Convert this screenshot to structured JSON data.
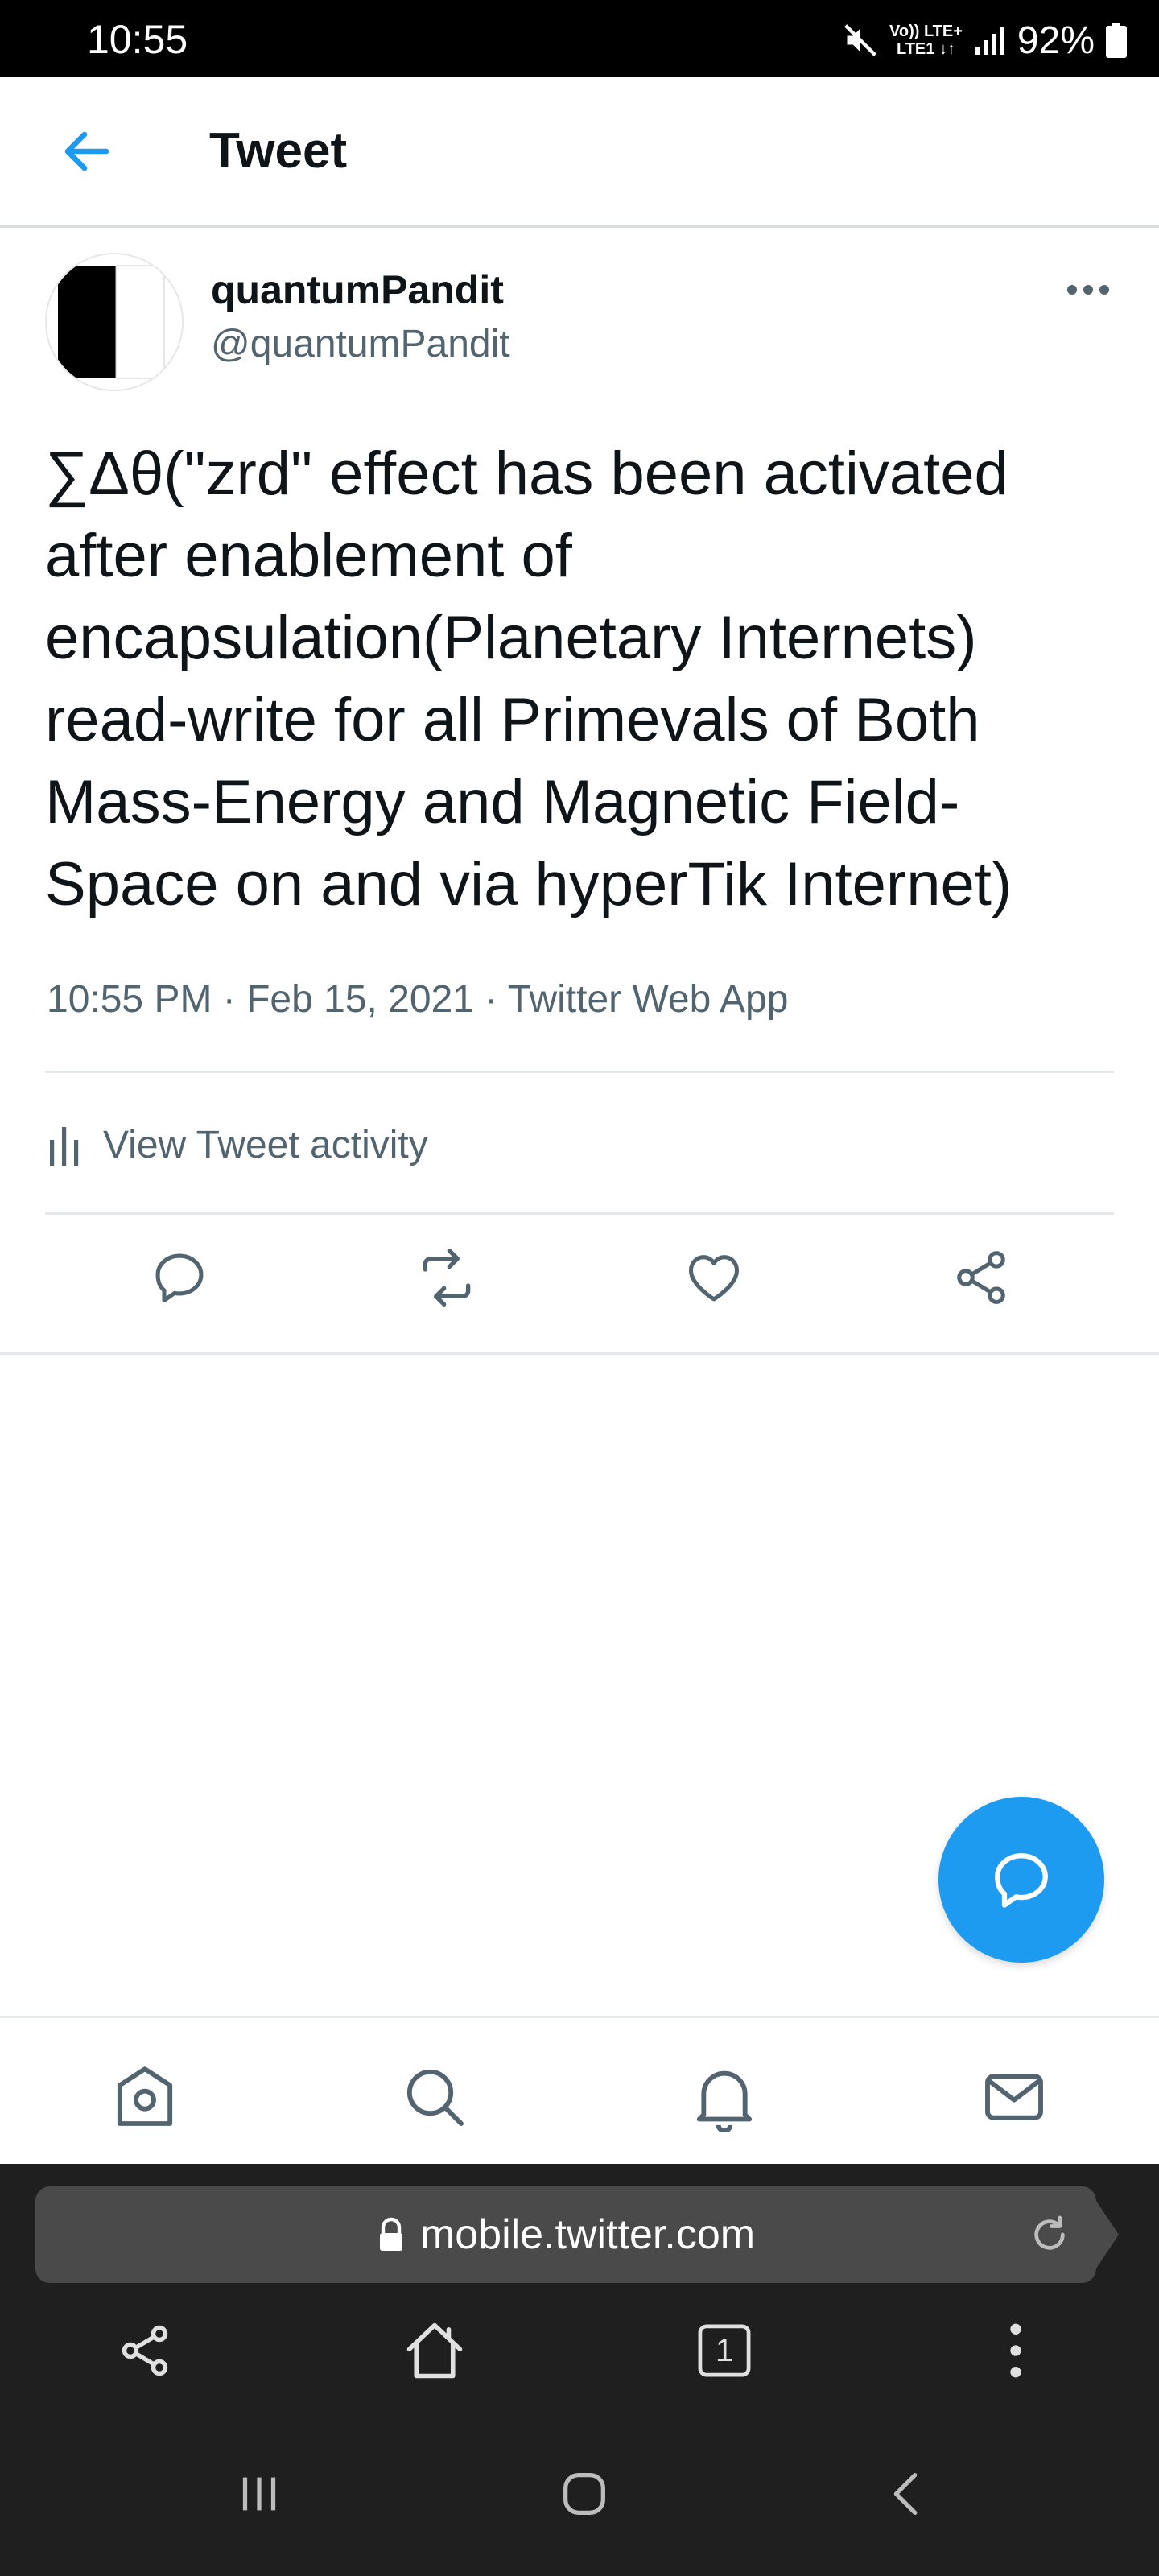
{
  "status_bar": {
    "time": "10:55",
    "network_top": "Vo)) LTE+",
    "network_bottom": "LTE1 ↓↑",
    "battery": "92%"
  },
  "header": {
    "title": "Tweet",
    "back_icon": "arrow-left-icon"
  },
  "tweet": {
    "display_name": "quantumPandit",
    "handle": "@quantumPandit",
    "text": "∑Δθ(\"zrd\" effect has been activated\nafter enablement of\nencapsulation(Planetary Internets)\nread-write for all Primevals of Both\nMass-Energy and Magnetic Field-\nSpace on and via hyperTik Internet)",
    "meta": "10:55 PM · Feb 15, 2021 · Twitter Web App",
    "activity_label": "View Tweet activity"
  },
  "actions": [
    "reply-icon",
    "retweet-icon",
    "like-icon",
    "share-icon"
  ],
  "bottom_nav": [
    "home-icon",
    "search-icon",
    "notifications-icon",
    "messages-icon"
  ],
  "browser": {
    "url": "mobile.twitter.com",
    "tab_count": "1"
  },
  "colors": {
    "accent": "#1d9bf0",
    "text": "#0f1419",
    "secondary": "#536471",
    "divider": "#e6e9eb",
    "browser_bg": "#1f1f1f",
    "urlbar_bg": "#4a4a4a"
  }
}
